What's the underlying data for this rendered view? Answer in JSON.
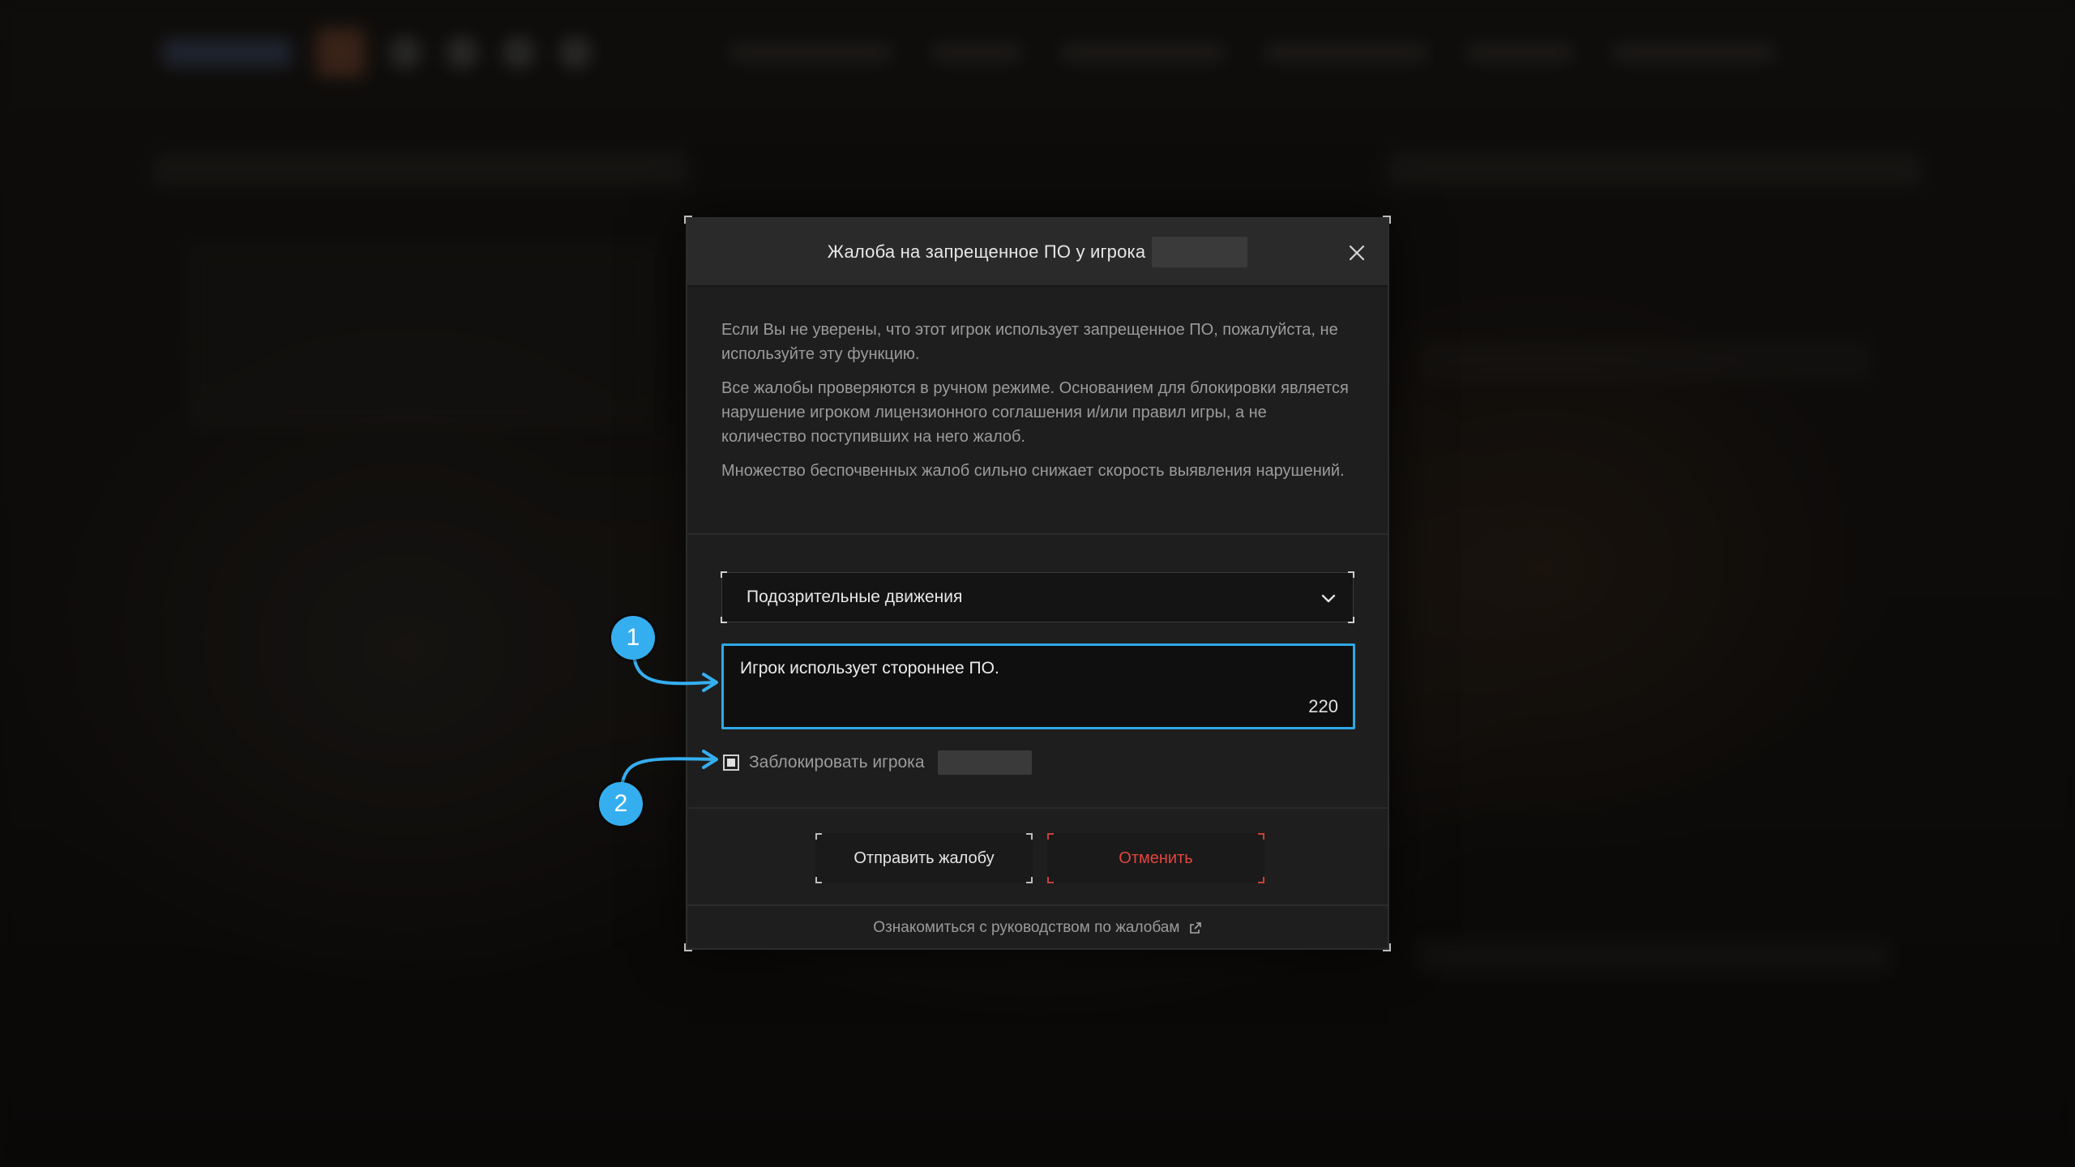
{
  "modal": {
    "title": "Жалоба на запрещенное ПО у игрока",
    "info": [
      "Если Вы не уверены, что этот игрок использует запрещенное ПО, пожалуйста, не используйте эту функцию.",
      "Все жалобы проверяются в ручном режиме. Основанием для блокировки является нарушение игроком лицензионного соглашения и/или правил игры, а не количество поступивших на него жалоб.",
      "Множество беспочвенных жалоб сильно снижает скорость выявления нарушений."
    ],
    "reason_select": {
      "value": "Подозрительные движения"
    },
    "comment": {
      "value": "Игрок использует стороннее ПО.",
      "counter": "220"
    },
    "block_checkbox": {
      "label": "Заблокировать игрока",
      "checked": true
    },
    "buttons": {
      "submit": "Отправить жалобу",
      "cancel": "Отменить"
    },
    "guide_link": "Ознакомиться с руководством по жалобам"
  },
  "annotations": {
    "step1": "1",
    "step2": "2",
    "color": "#35aef0"
  },
  "colors": {
    "accent": "#2ea8e6",
    "cancel": "#e2463f"
  }
}
